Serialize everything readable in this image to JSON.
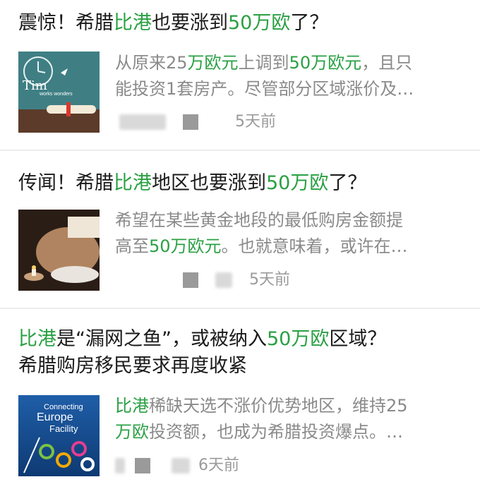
{
  "articles": [
    {
      "title": [
        {
          "t": "震惊！希腊",
          "hl": false
        },
        {
          "t": "比港",
          "hl": true
        },
        {
          "t": "也要涨到",
          "hl": false
        },
        {
          "t": "50万欧",
          "hl": true
        },
        {
          "t": "了？",
          "hl": false
        }
      ],
      "summary_line1": [
        {
          "t": "从原来25",
          "hl": false
        },
        {
          "t": "万欧元",
          "hl": true
        },
        {
          "t": "上调到",
          "hl": false
        },
        {
          "t": "50万欧元",
          "hl": true
        },
        {
          "t": "，且只",
          "hl": false
        }
      ],
      "summary_line2": [
        {
          "t": "能投资1套房产。尽管部分区域涨价及…",
          "hl": false
        }
      ],
      "time": "5天前",
      "thumb_text": {
        "a": "Tim",
        "b": "works wonders"
      },
      "icon": "clock-diploma-image"
    },
    {
      "title": [
        {
          "t": "传闻！希腊",
          "hl": false
        },
        {
          "t": "比港",
          "hl": true
        },
        {
          "t": "地区也要涨到",
          "hl": false
        },
        {
          "t": "50万欧",
          "hl": true
        },
        {
          "t": "了？",
          "hl": false
        }
      ],
      "summary_line1": [
        {
          "t": "希望在某些黄金地段的最低购房金额提",
          "hl": false
        }
      ],
      "summary_line2": [
        {
          "t": "高至",
          "hl": false
        },
        {
          "t": "50万欧元",
          "hl": true
        },
        {
          "t": "。也就意味着，或许在…",
          "hl": false
        }
      ],
      "time": "5天前",
      "icon": "reading-person-image"
    },
    {
      "title": [
        {
          "t": "比港",
          "hl": true
        },
        {
          "t": "是“漏网之鱼”，或被纳入",
          "hl": false
        },
        {
          "t": "50万欧",
          "hl": true
        },
        {
          "t": "区域？",
          "hl": false
        }
      ],
      "title_line2": "希腊购房移民要求再度收紧",
      "summary_line1": [
        {
          "t": "比港",
          "hl": true
        },
        {
          "t": "稀缺天选不涨价优势地区，维持25",
          "hl": false
        }
      ],
      "summary_line2": [
        {
          "t": "万欧",
          "hl": true
        },
        {
          "t": "投资额，也成为希腊投资爆点。…",
          "hl": false
        }
      ],
      "time": "6天前",
      "thumb_text": {
        "a": "Connecting",
        "b": "Europe",
        "c": "Facility"
      },
      "icon": "cef-poster-image"
    }
  ],
  "colors": {
    "highlight": "#2aa043",
    "summary": "#8a8a8a",
    "time": "#9a9a9a"
  }
}
